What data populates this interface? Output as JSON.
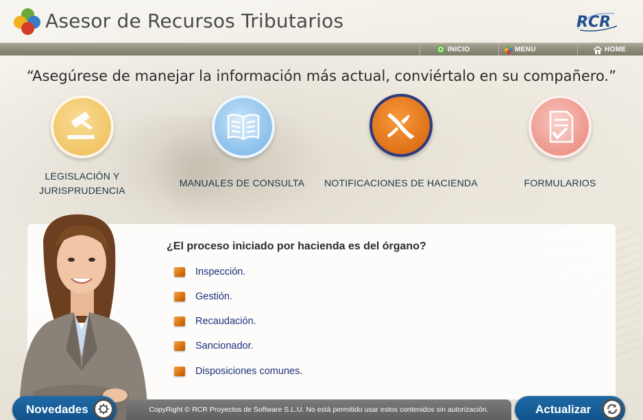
{
  "header": {
    "title": "Asesor de Recursos Tributarios",
    "brand": "RCR"
  },
  "nav": {
    "inicio": "INICIO",
    "menu": "MENU",
    "home": "HOME"
  },
  "quote": "“Asegúrese de manejar la información más actual, conviértalo en su compañero.”",
  "categories": [
    {
      "label_line1": "LEGISLACIÓN Y",
      "label_line2": "JURISPRUDENCIA",
      "icon": "gavel-icon",
      "color": "#f2c76a"
    },
    {
      "label_line1": "MANUALES DE CONSULTA",
      "icon": "open-book-icon",
      "color": "#8ec3ec"
    },
    {
      "label_line1": "NOTIFICACIONES DE HACIENDA",
      "icon": "hacienda-x-icon",
      "color": "#e0741a"
    },
    {
      "label_line1": "FORMULARIOS",
      "icon": "form-checklist-icon",
      "color": "#ee9a8f"
    }
  ],
  "question": {
    "text": "¿El proceso iniciado por hacienda es del órgano?",
    "options": [
      "Inspección.",
      "Gestión.",
      "Recaudación.",
      "Sancionador.",
      "Disposiciones comunes."
    ]
  },
  "footer": {
    "novedades": "Novedades",
    "actualizar": "Actualizar",
    "copyright": "CopyRight © RCR Proyectos de Software S.L.U. No está permitido usar estos contenidos sin autorización."
  },
  "colors": {
    "accent_blue": "#0f4f87",
    "nav_bar": "#8e8b7a",
    "option_bullet": "#d8700e",
    "option_text": "#1c2f7a"
  }
}
